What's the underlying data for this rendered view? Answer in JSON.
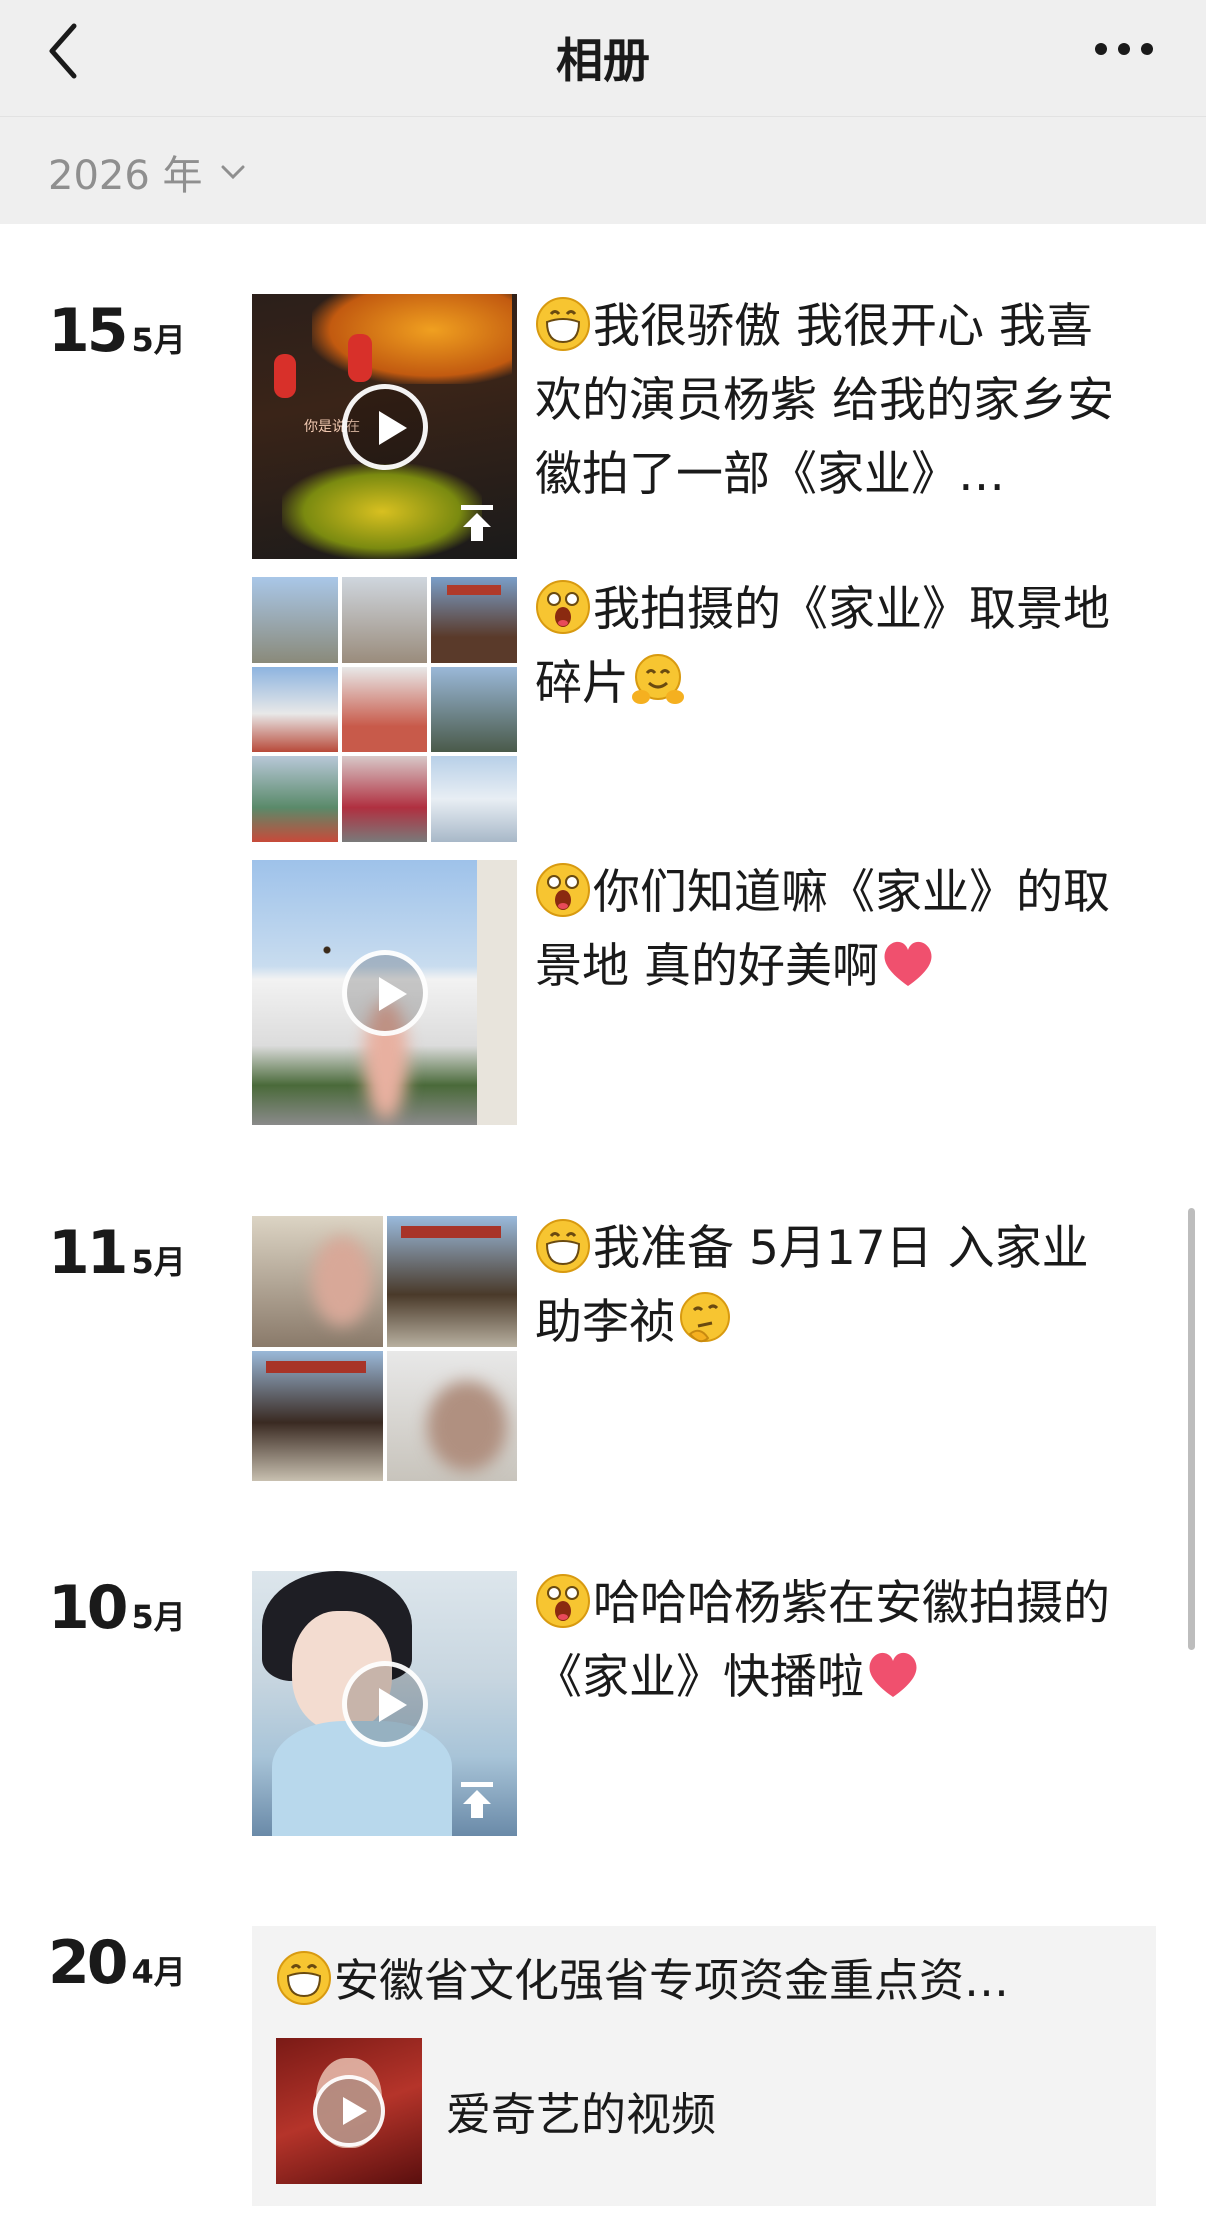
{
  "header": {
    "title": "相册",
    "back_icon": "chevron-left-icon",
    "more_icon": "more-dots-icon"
  },
  "filter": {
    "year_label": "2026 年",
    "icon": "chevron-down-icon"
  },
  "posts": [
    {
      "day": "15",
      "month": "5月",
      "text": "我很骄傲 我很开心 我喜欢的演员杨紫 给我的家乡安徽拍了一部《家业》…",
      "lead_emoji": "grin-emoji",
      "media": "video",
      "thumb_overlay": "你是说在"
    },
    {
      "text": "我拍摄的《家业》取景地碎片",
      "lead_emoji": "surprised-emoji",
      "tail_emoji": "hug-emoji",
      "media": "grid9"
    },
    {
      "text": "你们知道嘛《家业》的取景地 真的好美啊",
      "lead_emoji": "surprised-emoji",
      "tail_emoji": "heart-emoji",
      "media": "video"
    },
    {
      "day": "11",
      "month": "5月",
      "text": "我准备 5月17日 入家业助李祯",
      "lead_emoji": "grin-emoji",
      "tail_emoji": "thinking-emoji",
      "media": "grid4"
    },
    {
      "day": "10",
      "month": "5月",
      "text": "哈哈哈杨紫在安徽拍摄的《家业》快播啦",
      "lead_emoji": "surprised-emoji",
      "tail_emoji": "heart-emoji",
      "media": "video"
    },
    {
      "day": "20",
      "month": "4月",
      "share_title": "安徽省文化强省专项资金重点资…",
      "lead_emoji": "grin-emoji",
      "share_source": "爱奇艺的视频",
      "media": "share-video"
    }
  ],
  "colors": {
    "topbar": "#efefef",
    "text": "#1a1a1a",
    "muted": "#8f8f8f",
    "card": "#f3f3f3",
    "heart": "#f0506e",
    "emoji": "#f7c531"
  }
}
